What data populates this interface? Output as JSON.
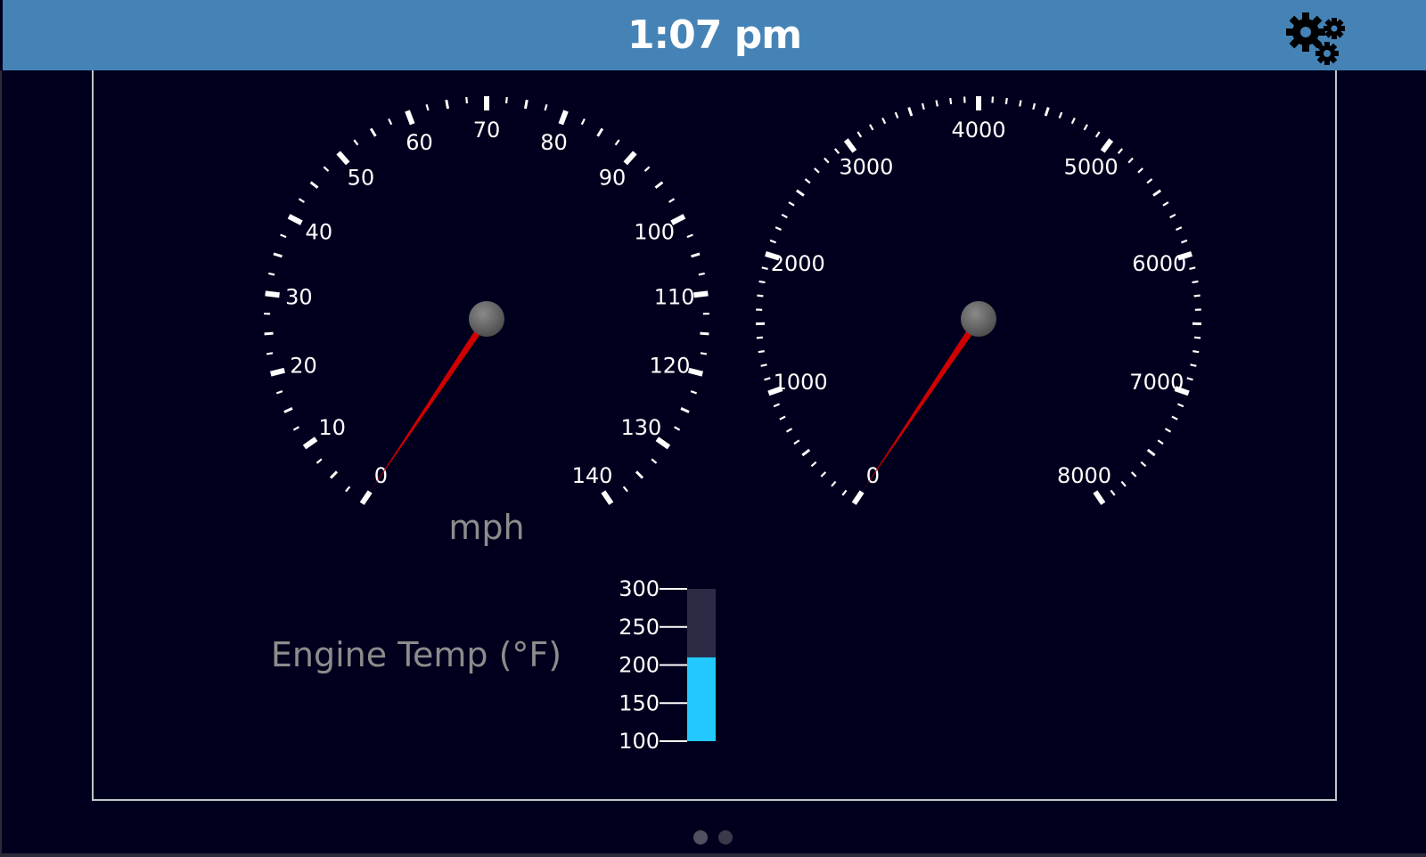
{
  "header": {
    "time": "1:07 pm",
    "settings_icon": "gears-icon",
    "background_color": "#4583b6"
  },
  "speedometer": {
    "unit_label": "mph",
    "min": 0,
    "max": 140,
    "major_step": 10,
    "value": 0,
    "labels": [
      "0",
      "10",
      "20",
      "30",
      "40",
      "50",
      "60",
      "70",
      "80",
      "90",
      "100",
      "110",
      "120",
      "130",
      "140"
    ]
  },
  "tachometer": {
    "min": 0,
    "max": 8000,
    "major_step": 1000,
    "value": 0,
    "labels": [
      "0",
      "1000",
      "2000",
      "3000",
      "4000",
      "5000",
      "6000",
      "7000",
      "8000"
    ]
  },
  "engine_temp": {
    "label": "Engine Temp (°F)",
    "min": 100,
    "max": 300,
    "value": 210,
    "ticks": [
      "300",
      "250",
      "200",
      "150",
      "100"
    ],
    "fill_color": "#22c8ff",
    "track_color": "#2b2b45"
  },
  "colors": {
    "background": "#00001e",
    "needle": "#d00000",
    "hub": "#6a6a6a",
    "tick": "#ffffff",
    "muted_label": "#8c8c8c"
  },
  "pager": {
    "pages": 2,
    "active_index": 0
  }
}
